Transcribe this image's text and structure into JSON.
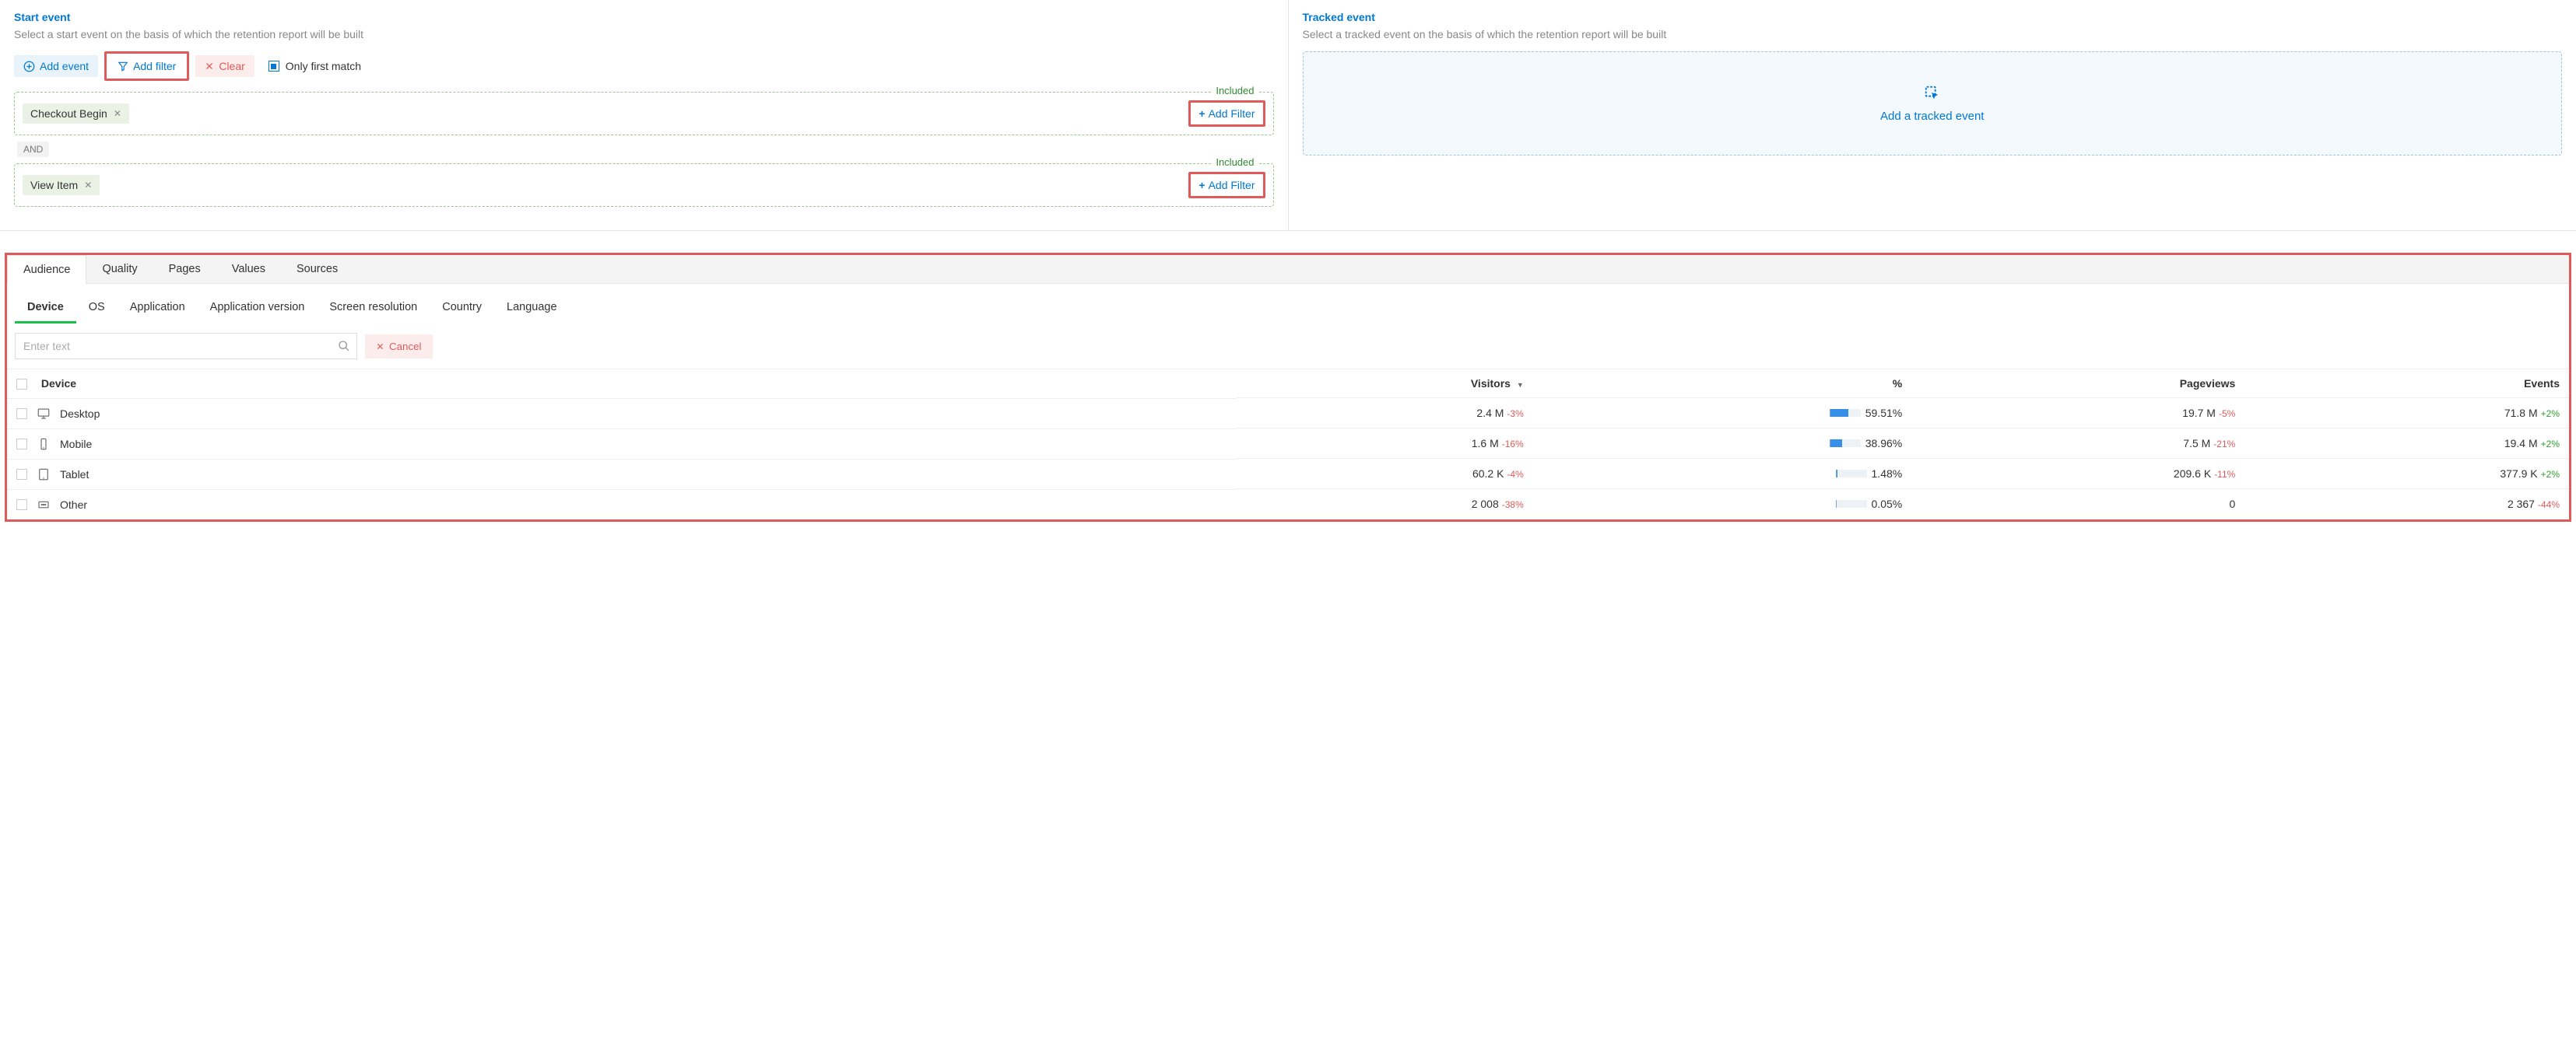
{
  "startEvent": {
    "title": "Start event",
    "desc": "Select a start event on the basis of which the retention report will be built",
    "addEvent": "Add event",
    "addFilter": "Add filter",
    "clear": "Clear",
    "onlyFirst": "Only first match",
    "includedLabel": "Included",
    "addFilterSmall": "Add Filter",
    "and": "AND",
    "events": [
      {
        "name": "Checkout Begin"
      },
      {
        "name": "View Item"
      }
    ]
  },
  "trackedEvent": {
    "title": "Tracked event",
    "desc": "Select a tracked event on the basis of which the retention report will be built",
    "cta": "Add a tracked event"
  },
  "tabsTop": [
    "Audience",
    "Quality",
    "Pages",
    "Values",
    "Sources"
  ],
  "tabsSub": [
    "Device",
    "OS",
    "Application",
    "Application version",
    "Screen resolution",
    "Country",
    "Language"
  ],
  "search": {
    "placeholder": "Enter text",
    "cancel": "Cancel"
  },
  "table": {
    "headers": {
      "device": "Device",
      "visitors": "Visitors",
      "pct": "%",
      "pageviews": "Pageviews",
      "events": "Events"
    },
    "rows": [
      {
        "icon": "desktop",
        "device": "Desktop",
        "visitors": "2.4 M",
        "visitorsDelta": "-3%",
        "pct": 59.51,
        "pctLabel": "59.51%",
        "pageviews": "19.7 M",
        "pageviewsDelta": "-5%",
        "events": "71.8 M",
        "eventsDelta": "+2%"
      },
      {
        "icon": "mobile",
        "device": "Mobile",
        "visitors": "1.6 M",
        "visitorsDelta": "-16%",
        "pct": 38.96,
        "pctLabel": "38.96%",
        "pageviews": "7.5 M",
        "pageviewsDelta": "-21%",
        "events": "19.4 M",
        "eventsDelta": "+2%"
      },
      {
        "icon": "tablet",
        "device": "Tablet",
        "visitors": "60.2 K",
        "visitorsDelta": "-4%",
        "pct": 1.48,
        "pctLabel": "1.48%",
        "pageviews": "209.6 K",
        "pageviewsDelta": "-11%",
        "events": "377.9 K",
        "eventsDelta": "+2%"
      },
      {
        "icon": "other",
        "device": "Other",
        "visitors": "2 008",
        "visitorsDelta": "-38%",
        "pct": 0.05,
        "pctLabel": "0.05%",
        "pageviews": "0",
        "pageviewsDelta": "",
        "events": "2 367",
        "eventsDelta": "-44%"
      }
    ]
  }
}
